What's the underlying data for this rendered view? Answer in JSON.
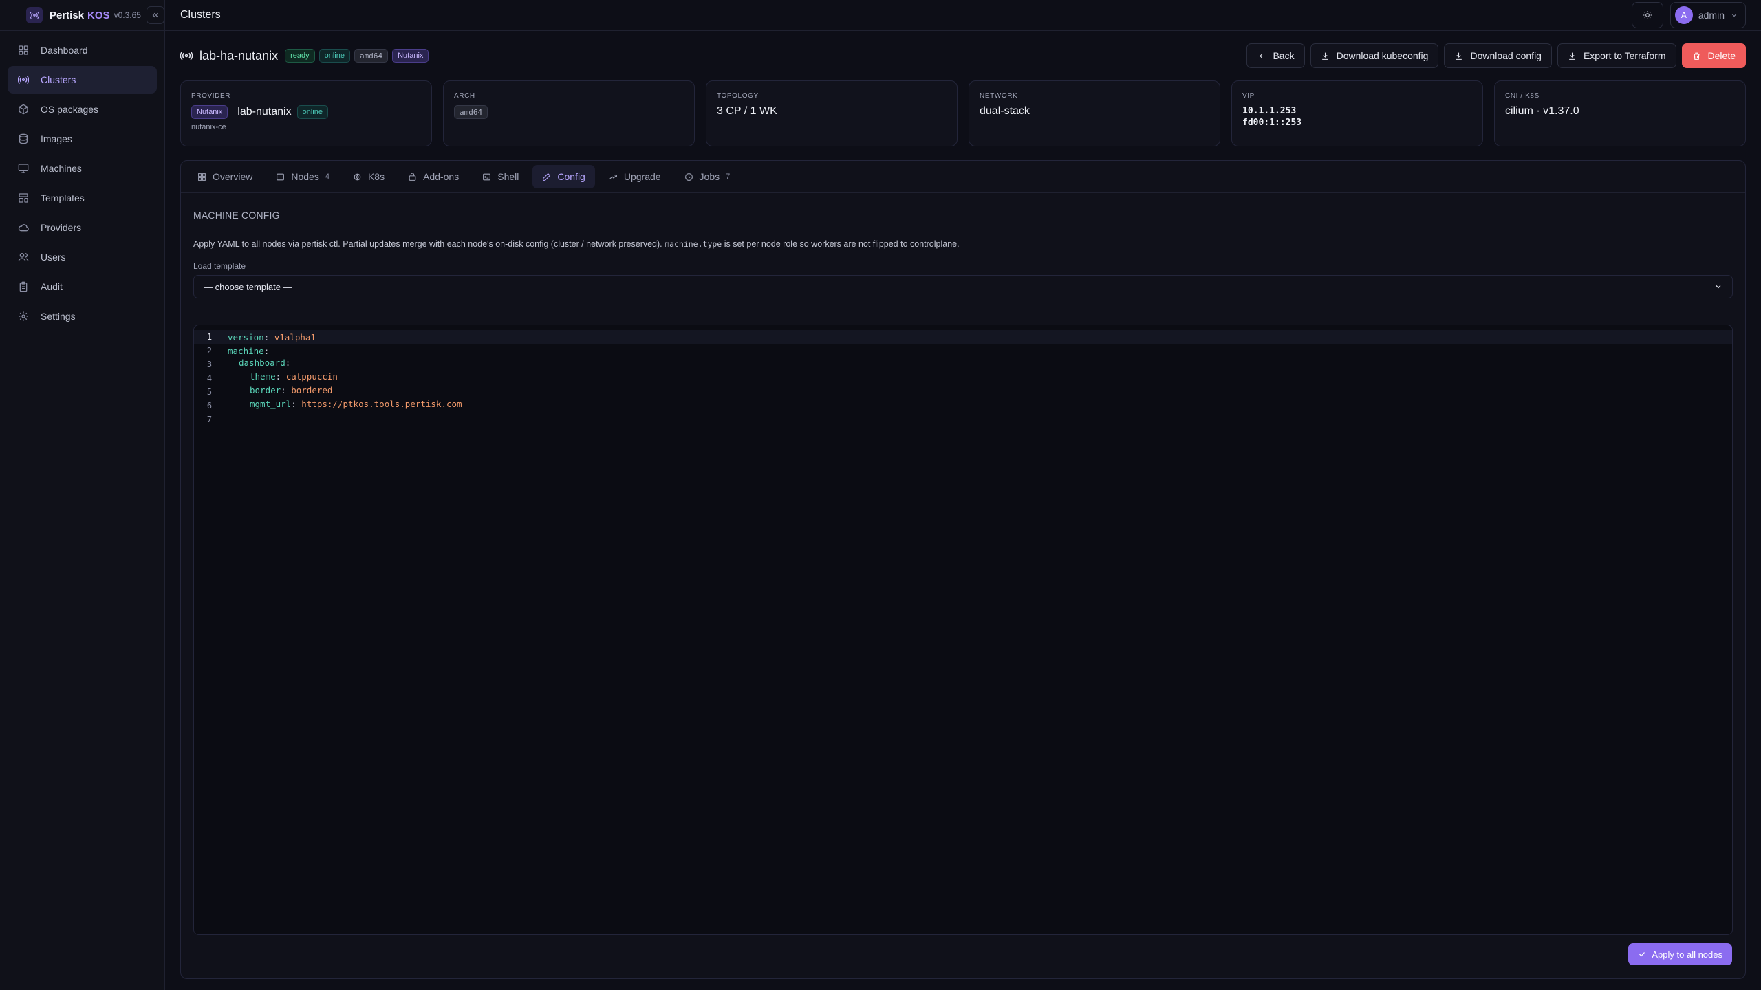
{
  "app": {
    "name": "Pertisk",
    "accent": "KOS",
    "version": "v0.3.65"
  },
  "sidebar": {
    "items": [
      {
        "label": "Dashboard",
        "icon": "dashboard-icon"
      },
      {
        "label": "Clusters",
        "icon": "cluster-icon",
        "active": true
      },
      {
        "label": "OS packages",
        "icon": "package-icon"
      },
      {
        "label": "Images",
        "icon": "database-icon"
      },
      {
        "label": "Machines",
        "icon": "monitor-icon"
      },
      {
        "label": "Templates",
        "icon": "template-icon"
      },
      {
        "label": "Providers",
        "icon": "cloud-icon"
      },
      {
        "label": "Users",
        "icon": "users-icon"
      },
      {
        "label": "Audit",
        "icon": "clipboard-icon"
      },
      {
        "label": "Settings",
        "icon": "gear-icon"
      }
    ]
  },
  "topbar": {
    "title": "Clusters",
    "user": {
      "initial": "A",
      "name": "admin"
    }
  },
  "cluster": {
    "name": "lab-ha-nutanix",
    "badges": {
      "status": "ready",
      "state": "online",
      "arch": "amd64",
      "provider": "Nutanix"
    }
  },
  "actions": {
    "back": "Back",
    "download_kubeconfig": "Download kubeconfig",
    "download_config": "Download config",
    "export": "Export to Terraform",
    "delete": "Delete"
  },
  "cards": {
    "provider": {
      "label": "PROVIDER",
      "badge": "Nutanix",
      "name": "lab-nutanix",
      "status": "online",
      "sub": "nutanix-ce"
    },
    "arch": {
      "label": "ARCH",
      "value": "amd64"
    },
    "topology": {
      "label": "TOPOLOGY",
      "value": "3 CP / 1 WK"
    },
    "network": {
      "label": "NETWORK",
      "value": "dual-stack"
    },
    "vip": {
      "label": "VIP",
      "ipv4": "10.1.1.253",
      "ipv6": "fd00:1::253"
    },
    "cni": {
      "label": "CNI / K8S",
      "value": "cilium · v1.37.0"
    }
  },
  "tabs": [
    {
      "label": "Overview",
      "icon": "grid-icon"
    },
    {
      "label": "Nodes",
      "count": "4",
      "icon": "server-icon"
    },
    {
      "label": "K8s",
      "icon": "helm-icon"
    },
    {
      "label": "Add-ons",
      "icon": "package-icon"
    },
    {
      "label": "Shell",
      "icon": "terminal-icon"
    },
    {
      "label": "Config",
      "icon": "pencil-icon",
      "active": true
    },
    {
      "label": "Upgrade",
      "icon": "trend-icon"
    },
    {
      "label": "Jobs",
      "count": "7",
      "icon": "clock-icon"
    }
  ],
  "config": {
    "title": "MACHINE CONFIG",
    "desc_before": "Apply YAML to all nodes via pertisk ctl. Partial updates merge with each node's on-disk config (cluster / network preserved).",
    "desc_code": "machine.type",
    "desc_after": "is set per node role so workers are not flipped to controlplane.",
    "template_label": "Load template",
    "template_value": "— choose template —",
    "apply": "Apply to all nodes"
  },
  "editor": {
    "lines": [
      {
        "n": "1",
        "key": "version",
        "value": "v1alpha1",
        "indent": 0
      },
      {
        "n": "2",
        "key": "machine",
        "value": "",
        "indent": 0
      },
      {
        "n": "3",
        "key": "dashboard",
        "value": "",
        "indent": 1
      },
      {
        "n": "4",
        "key": "theme",
        "value": "catppuccin",
        "indent": 2
      },
      {
        "n": "5",
        "key": "border",
        "value": "bordered",
        "indent": 2
      },
      {
        "n": "6",
        "key": "mgmt_url",
        "value": "https://ptkos.tools.pertisk.com",
        "indent": 2,
        "url": true
      },
      {
        "n": "7",
        "key": "",
        "value": "",
        "indent": 0
      }
    ]
  },
  "colors": {
    "accent": "#8b6cf0",
    "danger": "#ef5b5b",
    "background": "#0d0e17"
  }
}
